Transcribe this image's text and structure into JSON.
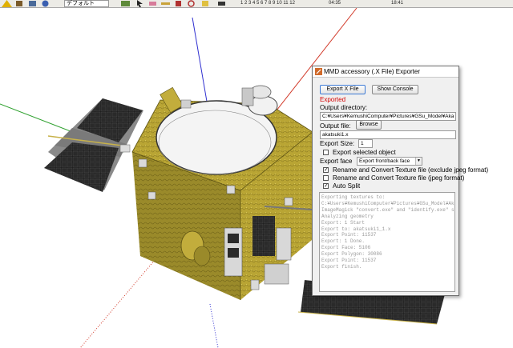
{
  "toolbar": {
    "combo_value": "デフォルト",
    "scale_numbers": "1 2 3 4 5 6 7 8 9 10 11 12",
    "time_left": "04:35",
    "time_right": "18:41"
  },
  "dialog": {
    "title": "MMD accessory (.X File) Exporter",
    "export_button": "Export X File",
    "show_console_button": "Show Console",
    "status": "Exported",
    "output_dir_label": "Output directory:",
    "output_dir_value": "C:¥Users¥KemushiComputer¥Pictures¥GSu_Model¥Aka",
    "output_file_label": "Output file:",
    "browse_button": "Browse",
    "output_file_value": "akatsuki1.x",
    "export_size_label": "Export Size:",
    "export_size_value": "1",
    "export_selected_label": "Export selected object",
    "export_face_label": "Export face",
    "export_face_value": "Export front/back face",
    "rename_exclude_label": "Rename and Convert Texture file (exclude jpeg format)",
    "rename_jpeg_label": "Rename and Convert Texture file (jpeg format)",
    "auto_split_label": "Auto Split",
    "checks": {
      "export_selected": false,
      "rename_exclude": true,
      "rename_jpeg": false,
      "auto_split": true
    },
    "log_lines": [
      "Exporting textures to:",
      "C:¥Users¥KemushiComputer¥Pictures¥GSu_Model¥Akatsuki¥PlanetC",
      "ImageMagick \"convert.exe\" and \"identify.exe\" serching...",
      "Analyzing geometry",
      "Export: 1 Start",
      "Export to: akatsuki1_1.x",
      "Export Point: 11537",
      "Export: 1 Done.",
      "Export Face: 5106",
      "Export Polygon: 30086",
      "Export Point: 11537",
      "Export finish."
    ]
  },
  "colors": {
    "gold": "#b9a534",
    "panel_blue": "#1e2c44",
    "panel_black": "#1b1b1b",
    "axis_red": "#d23a2a",
    "axis_green": "#2ea02e",
    "axis_blue": "#3030d0"
  }
}
